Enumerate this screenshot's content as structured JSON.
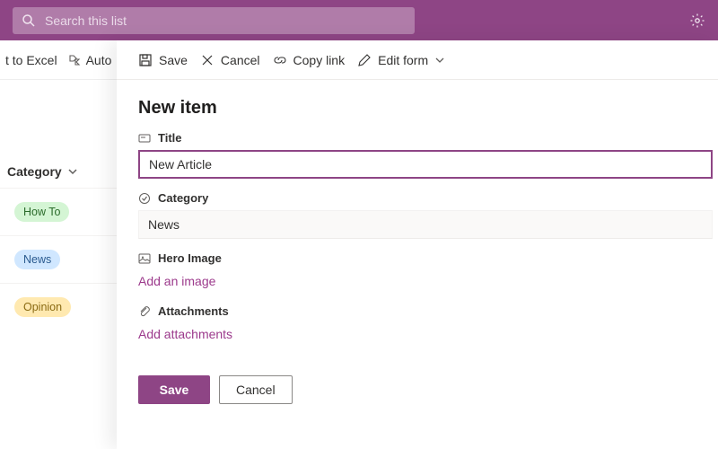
{
  "header": {
    "search_placeholder": "Search this list"
  },
  "left_toolbar": {
    "excel": "t to Excel",
    "auto": "Auto"
  },
  "left_column": {
    "header": "Category",
    "rows": [
      {
        "label": "How To",
        "color": "green"
      },
      {
        "label": "News",
        "color": "blue"
      },
      {
        "label": "Opinion",
        "color": "yellow"
      }
    ]
  },
  "panel": {
    "toolbar": {
      "save": "Save",
      "cancel": "Cancel",
      "copy_link": "Copy link",
      "edit_form": "Edit form"
    },
    "title": "New item",
    "fields": {
      "title": {
        "label": "Title",
        "value": "New Article"
      },
      "category": {
        "label": "Category",
        "value": "News"
      },
      "hero": {
        "label": "Hero Image",
        "action": "Add an image"
      },
      "attachments": {
        "label": "Attachments",
        "action": "Add attachments"
      }
    },
    "footer": {
      "save": "Save",
      "cancel": "Cancel"
    }
  }
}
